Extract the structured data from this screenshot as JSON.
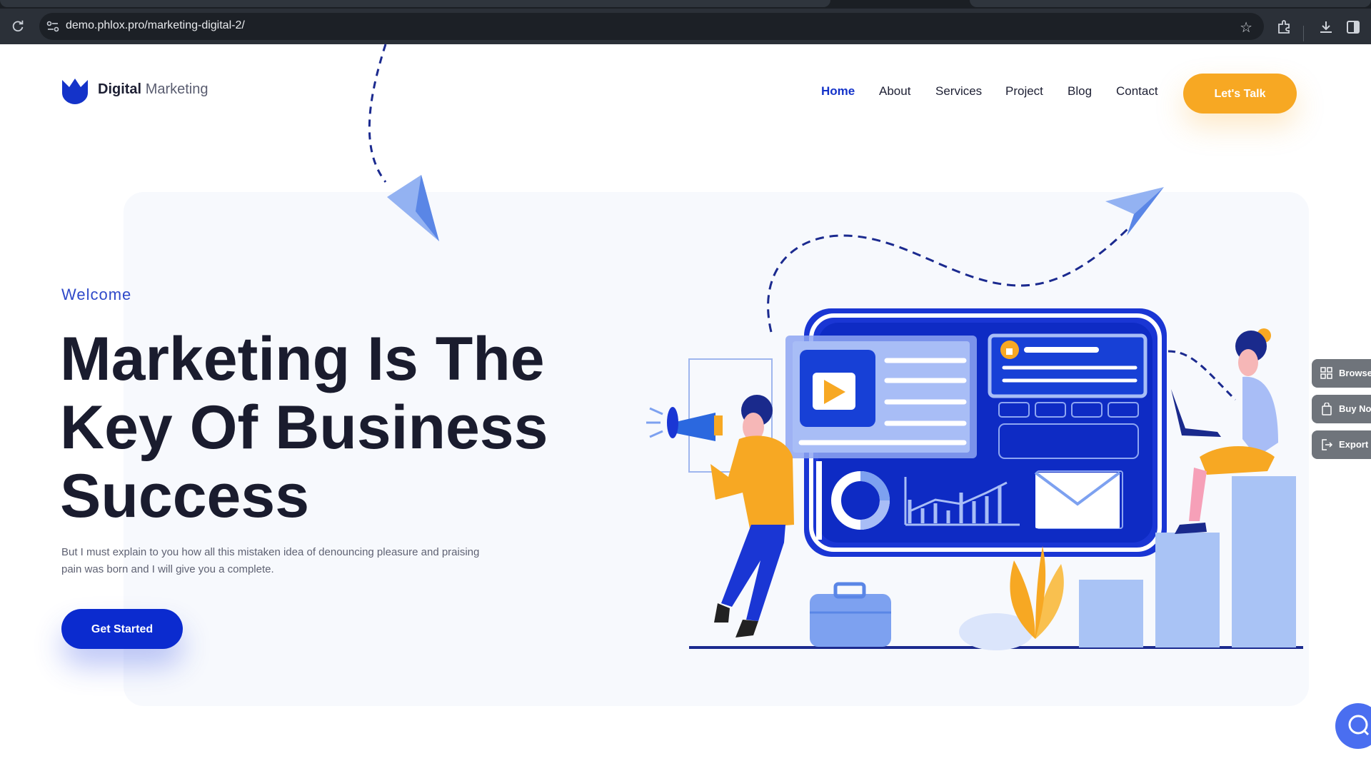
{
  "browser": {
    "url": "demo.phlox.pro/marketing-digital-2/",
    "icons": [
      "reload-icon",
      "site-info-icon",
      "star-icon",
      "extensions-icon",
      "download-icon",
      "sidebar-icon"
    ]
  },
  "header": {
    "logo_bold": "Digital",
    "logo_light": "Marketing",
    "nav": [
      "Home",
      "About",
      "Services",
      "Project",
      "Blog",
      "Contact"
    ],
    "active_nav": "Home",
    "cta_label": "Let's Talk"
  },
  "hero": {
    "eyebrow": "Welcome",
    "headline_lines": [
      "Marketing Is The",
      "Key Of Business",
      "Success"
    ],
    "subtext": "But I must explain to you how all this mistaken idea of denouncing pleasure and praising pain was born and I will give you a complete.",
    "cta_label": "Get Started"
  },
  "side_panel": {
    "items": [
      {
        "label": "Browse",
        "icon": "grid-icon"
      },
      {
        "label": "Buy No",
        "icon": "bag-icon"
      },
      {
        "label": "Export",
        "icon": "export-icon"
      }
    ]
  },
  "colors": {
    "brand_blue": "#0b2bcf",
    "accent_orange": "#f7a823",
    "text_dark": "#1a1c2e",
    "chrome_bg": "#2b3038"
  }
}
